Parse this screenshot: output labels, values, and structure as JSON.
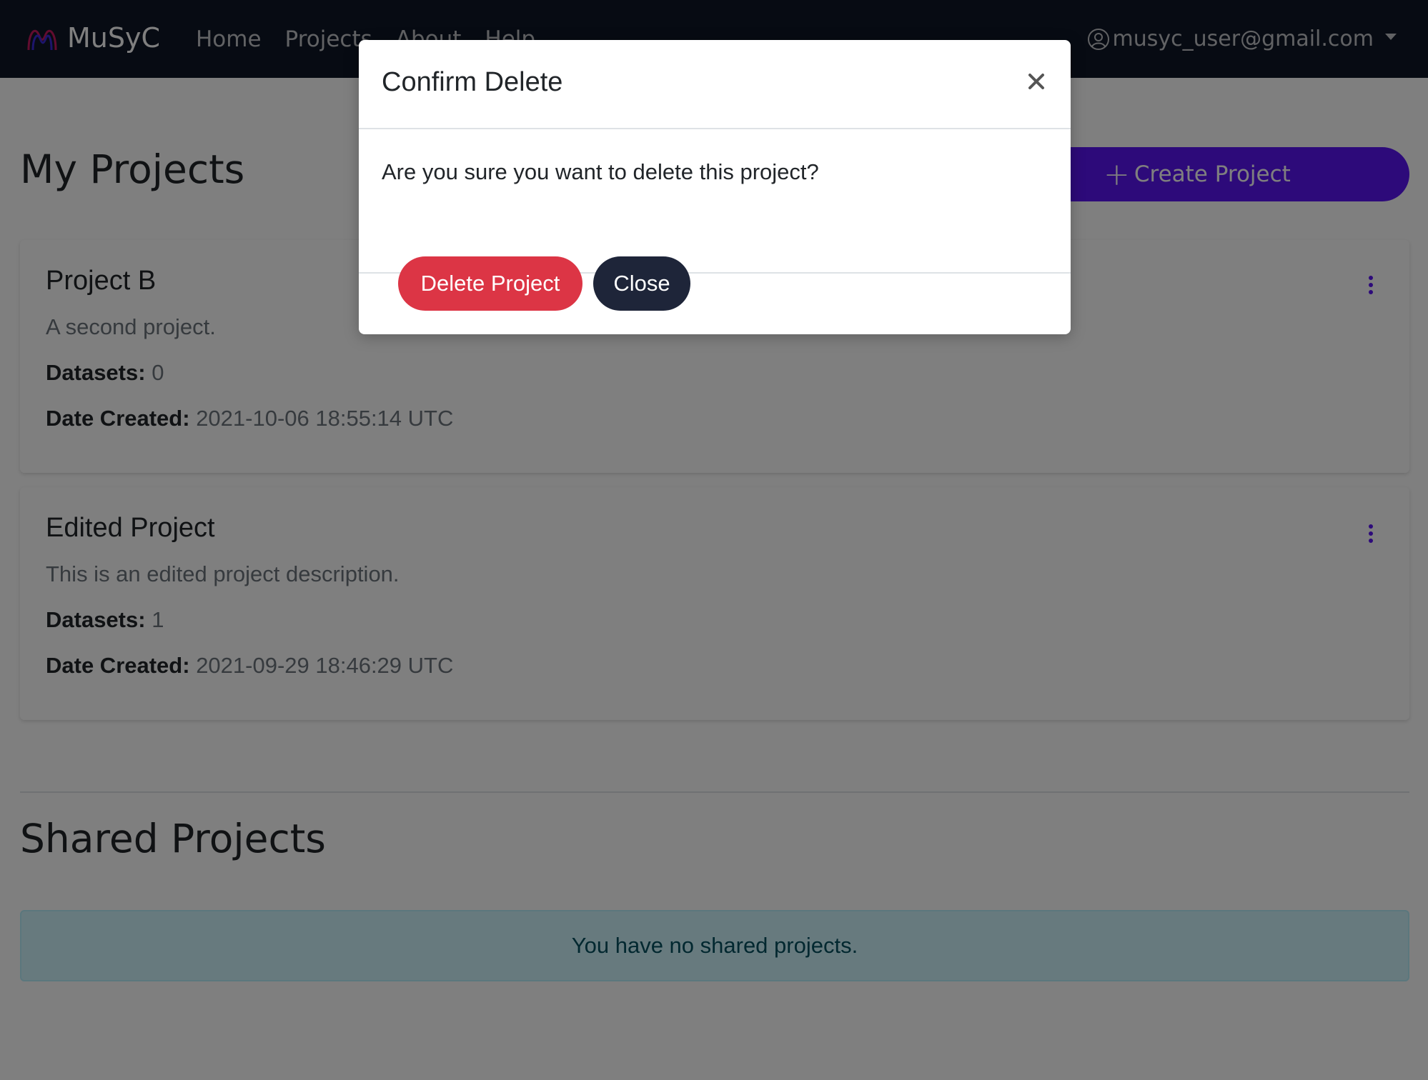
{
  "navbar": {
    "brand": "MuSyC",
    "links": [
      "Home",
      "Projects",
      "About",
      "Help"
    ],
    "user_email": "musyc_user@gmail.com"
  },
  "my_projects": {
    "title": "My Projects",
    "create_label": "Create Project",
    "cards": [
      {
        "name": "Project B",
        "description": "A second project.",
        "datasets_label": "Datasets:",
        "datasets": "0",
        "date_label": "Date Created:",
        "date": "2021-10-06 18:55:14 UTC"
      },
      {
        "name": "Edited Project",
        "description": "This is an edited project description.",
        "datasets_label": "Datasets:",
        "datasets": "1",
        "date_label": "Date Created:",
        "date": "2021-09-29 18:46:29 UTC"
      }
    ]
  },
  "shared_projects": {
    "title": "Shared Projects",
    "empty_message": "You have no shared projects."
  },
  "modal": {
    "title": "Confirm Delete",
    "message": "Are you sure you want to delete this project?",
    "delete_label": "Delete Project",
    "close_label": "Close"
  },
  "colors": {
    "navbar": "#0f1626",
    "primary": "#5a14f5",
    "danger": "#dc3545",
    "dark_button": "#1e2539",
    "info_bg": "#cff4fc"
  }
}
